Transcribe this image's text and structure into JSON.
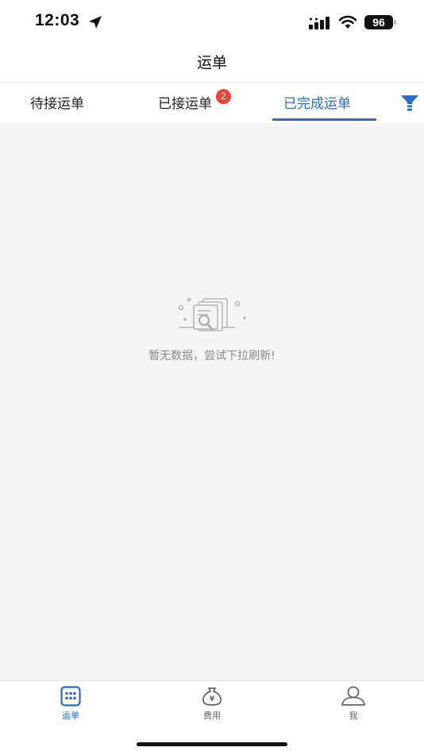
{
  "status_bar": {
    "time": "12:03",
    "battery": "96"
  },
  "nav": {
    "title": "运单"
  },
  "tabs": [
    {
      "label": "待接运单",
      "active": false
    },
    {
      "label": "已接运单",
      "active": false,
      "badge": "2"
    },
    {
      "label": "已完成运单",
      "active": true
    }
  ],
  "empty_state": {
    "message": "暂无数据，尝试下拉刷新!"
  },
  "bottom_nav": [
    {
      "label": "运单",
      "icon": "orders-grid-icon",
      "active": true
    },
    {
      "label": "费用",
      "icon": "money-bag-icon",
      "active": false,
      "glyph": "¥"
    },
    {
      "label": "我",
      "icon": "person-icon",
      "active": false
    }
  ],
  "colors": {
    "accent": "#2a6bc4",
    "badge": "#e8463a",
    "content_bg": "#f5f5f5",
    "empty_text": "#8a8a8a"
  }
}
